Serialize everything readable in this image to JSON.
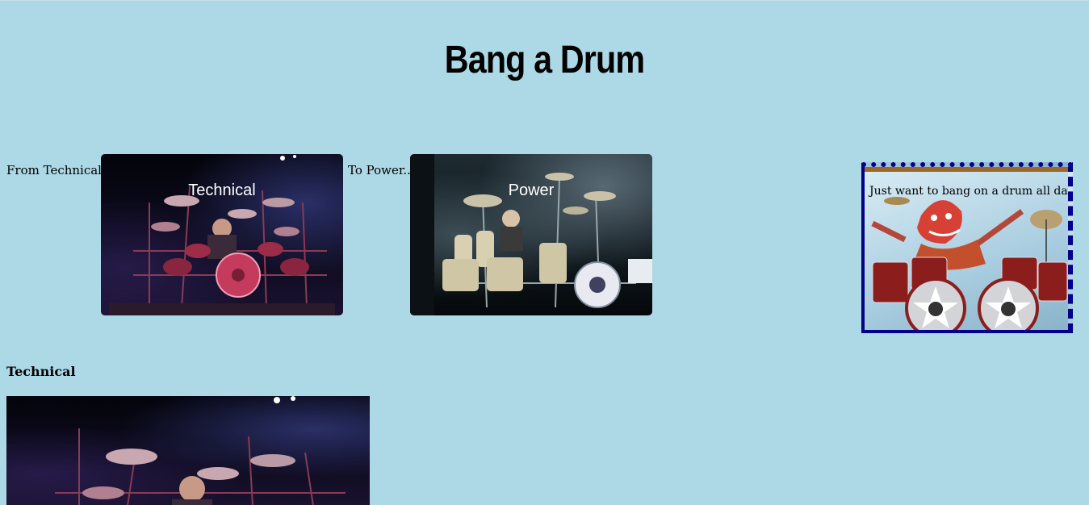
{
  "header": {
    "title": "Bang a Drum"
  },
  "gallery": {
    "from_text": "From Technical...",
    "to_text": "To Power...",
    "cards": [
      {
        "label": "Technical"
      },
      {
        "label": "Power"
      }
    ]
  },
  "aside": {
    "caption": "Just want to bang on a drum all day"
  },
  "section": {
    "heading": "Technical"
  },
  "colors": {
    "background": "#add8e6",
    "aside_border": "#00008b"
  }
}
